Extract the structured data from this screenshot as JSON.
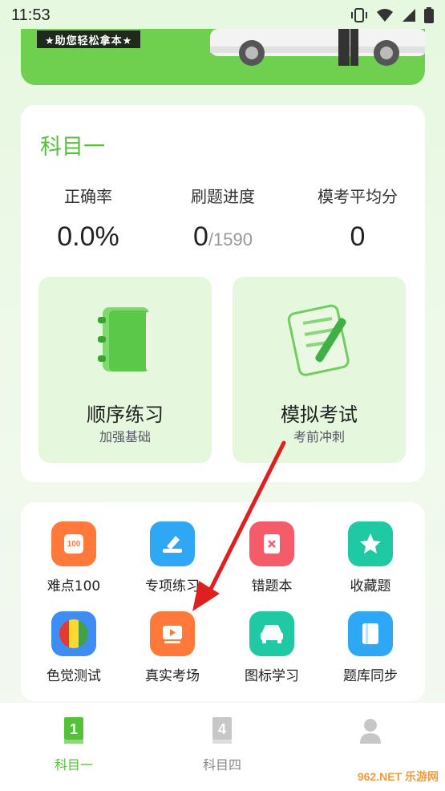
{
  "status": {
    "time": "11:53"
  },
  "banner": {
    "tagline": "★助您轻松拿本★"
  },
  "subject": {
    "title": "科目一",
    "stats": [
      {
        "label": "正确率",
        "value": "0.0%"
      },
      {
        "label": "刷题进度",
        "value": "0",
        "total": "/1590"
      },
      {
        "label": "模考平均分",
        "value": "0"
      }
    ],
    "modes": [
      {
        "title": "顺序练习",
        "subtitle": "加强基础"
      },
      {
        "title": "模拟考试",
        "subtitle": "考前冲刺"
      }
    ]
  },
  "tools": [
    {
      "label": "难点100",
      "icon": "hundred-icon",
      "color": "#ff7a3a"
    },
    {
      "label": "专项练习",
      "icon": "edit-icon",
      "color": "#2ea8f5"
    },
    {
      "label": "错题本",
      "icon": "wrong-book-icon",
      "color": "#f45c6a"
    },
    {
      "label": "收藏题",
      "icon": "star-icon",
      "color": "#1fc9a4"
    },
    {
      "label": "色觉测试",
      "icon": "color-test-icon",
      "color": "#3d8df5"
    },
    {
      "label": "真实考场",
      "icon": "video-icon",
      "color": "#ff7a3a"
    },
    {
      "label": "图标学习",
      "icon": "car-icon",
      "color": "#1fc9a4"
    },
    {
      "label": "题库同步",
      "icon": "document-icon",
      "color": "#2ea8f5"
    }
  ],
  "tabs": [
    {
      "label": "科目一",
      "badge": "1",
      "active": true
    },
    {
      "label": "科目四",
      "badge": "4",
      "active": false
    },
    {
      "label": "",
      "badge": "",
      "active": false
    }
  ],
  "watermark": "962.NET 乐游网",
  "colors": {
    "accent": "#53c236",
    "banner": "#6fd04f",
    "arrow": "#e02020"
  }
}
